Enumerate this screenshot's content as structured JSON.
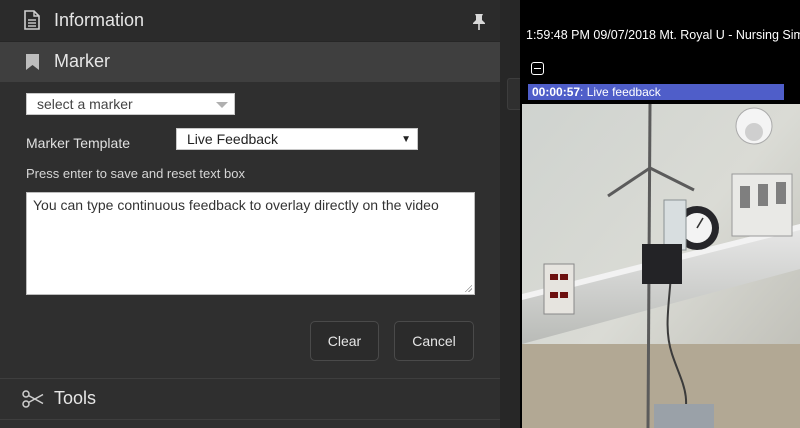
{
  "panel": {
    "information_title": "Information",
    "marker_title": "Marker",
    "tools_title": "Tools"
  },
  "marker_form": {
    "select_marker_value": "select a marker",
    "template_label": "Marker Template",
    "template_value": "Live Feedback",
    "hint": "Press enter to save and reset text box",
    "textarea_value": "You can type continuous feedback to overlay directly on the video",
    "clear_label": "Clear",
    "cancel_label": "Cancel"
  },
  "video": {
    "timestamp": "1:59:48 PM 09/07/2018 Mt. Royal U - Nursing Sim",
    "overlay_time": "00:00:57",
    "overlay_text": ": Live feedback"
  },
  "colors": {
    "overlay_bg": "#4f5ec9",
    "panel_bg": "#2f2f2f",
    "header_active_bg": "#3f3f3f"
  }
}
